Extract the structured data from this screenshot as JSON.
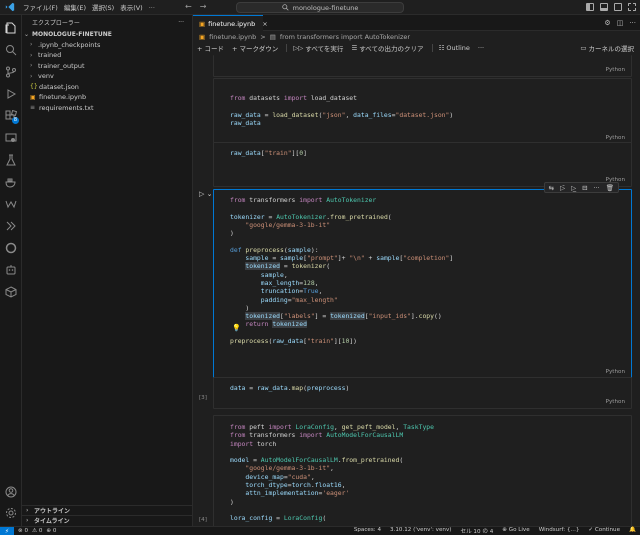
{
  "titlebar": {
    "menu": [
      "ファイル(F)",
      "編集(E)",
      "選択(S)",
      "表示(V)",
      "..."
    ],
    "command_center": "monologue-finetune",
    "nav_back": "←",
    "nav_forward": "→"
  },
  "sidebar": {
    "header": "エクスプローラー",
    "header_more": "···",
    "root": "MONOLOGUE-FINETUNE",
    "items": [
      {
        "label": ".ipynb_checkpoints",
        "type": "folder"
      },
      {
        "label": "trained",
        "type": "folder"
      },
      {
        "label": "trainer_output",
        "type": "folder"
      },
      {
        "label": "venv",
        "type": "folder"
      },
      {
        "label": "dataset.json",
        "type": "json"
      },
      {
        "label": "finetune.ipynb",
        "type": "notebook"
      },
      {
        "label": "requirements.txt",
        "type": "text"
      }
    ],
    "sections": [
      "アウトライン",
      "タイムライン"
    ]
  },
  "activity": {
    "badge": "8"
  },
  "editor": {
    "tab": {
      "label": "finetune.ipynb",
      "close": "×"
    },
    "breadcrumb": [
      "finetune.ipynb",
      ">",
      "from transformers import AutoTokenizer"
    ],
    "toolbar": {
      "code": "+ コード",
      "markdown": "+ マークダウン",
      "run_all": "すべてを実行",
      "clear": "すべての出力のクリア",
      "outline": "Outline",
      "more": "···"
    },
    "kernel": "カーネルの選択",
    "lang": "Python"
  },
  "cells": {
    "exec_labels": [
      "[3]",
      "[4]"
    ]
  },
  "statusbar": {
    "left": [
      "⊗ 0",
      "⚠ 0",
      "⊕ 0"
    ],
    "right": [
      "Spaces: 4",
      "3.10.12 ('venv': venv)",
      "セル 10 の 4",
      "⊕ Go Live",
      "Windsurf: {...}",
      "✓ Continue",
      "🔔"
    ]
  }
}
